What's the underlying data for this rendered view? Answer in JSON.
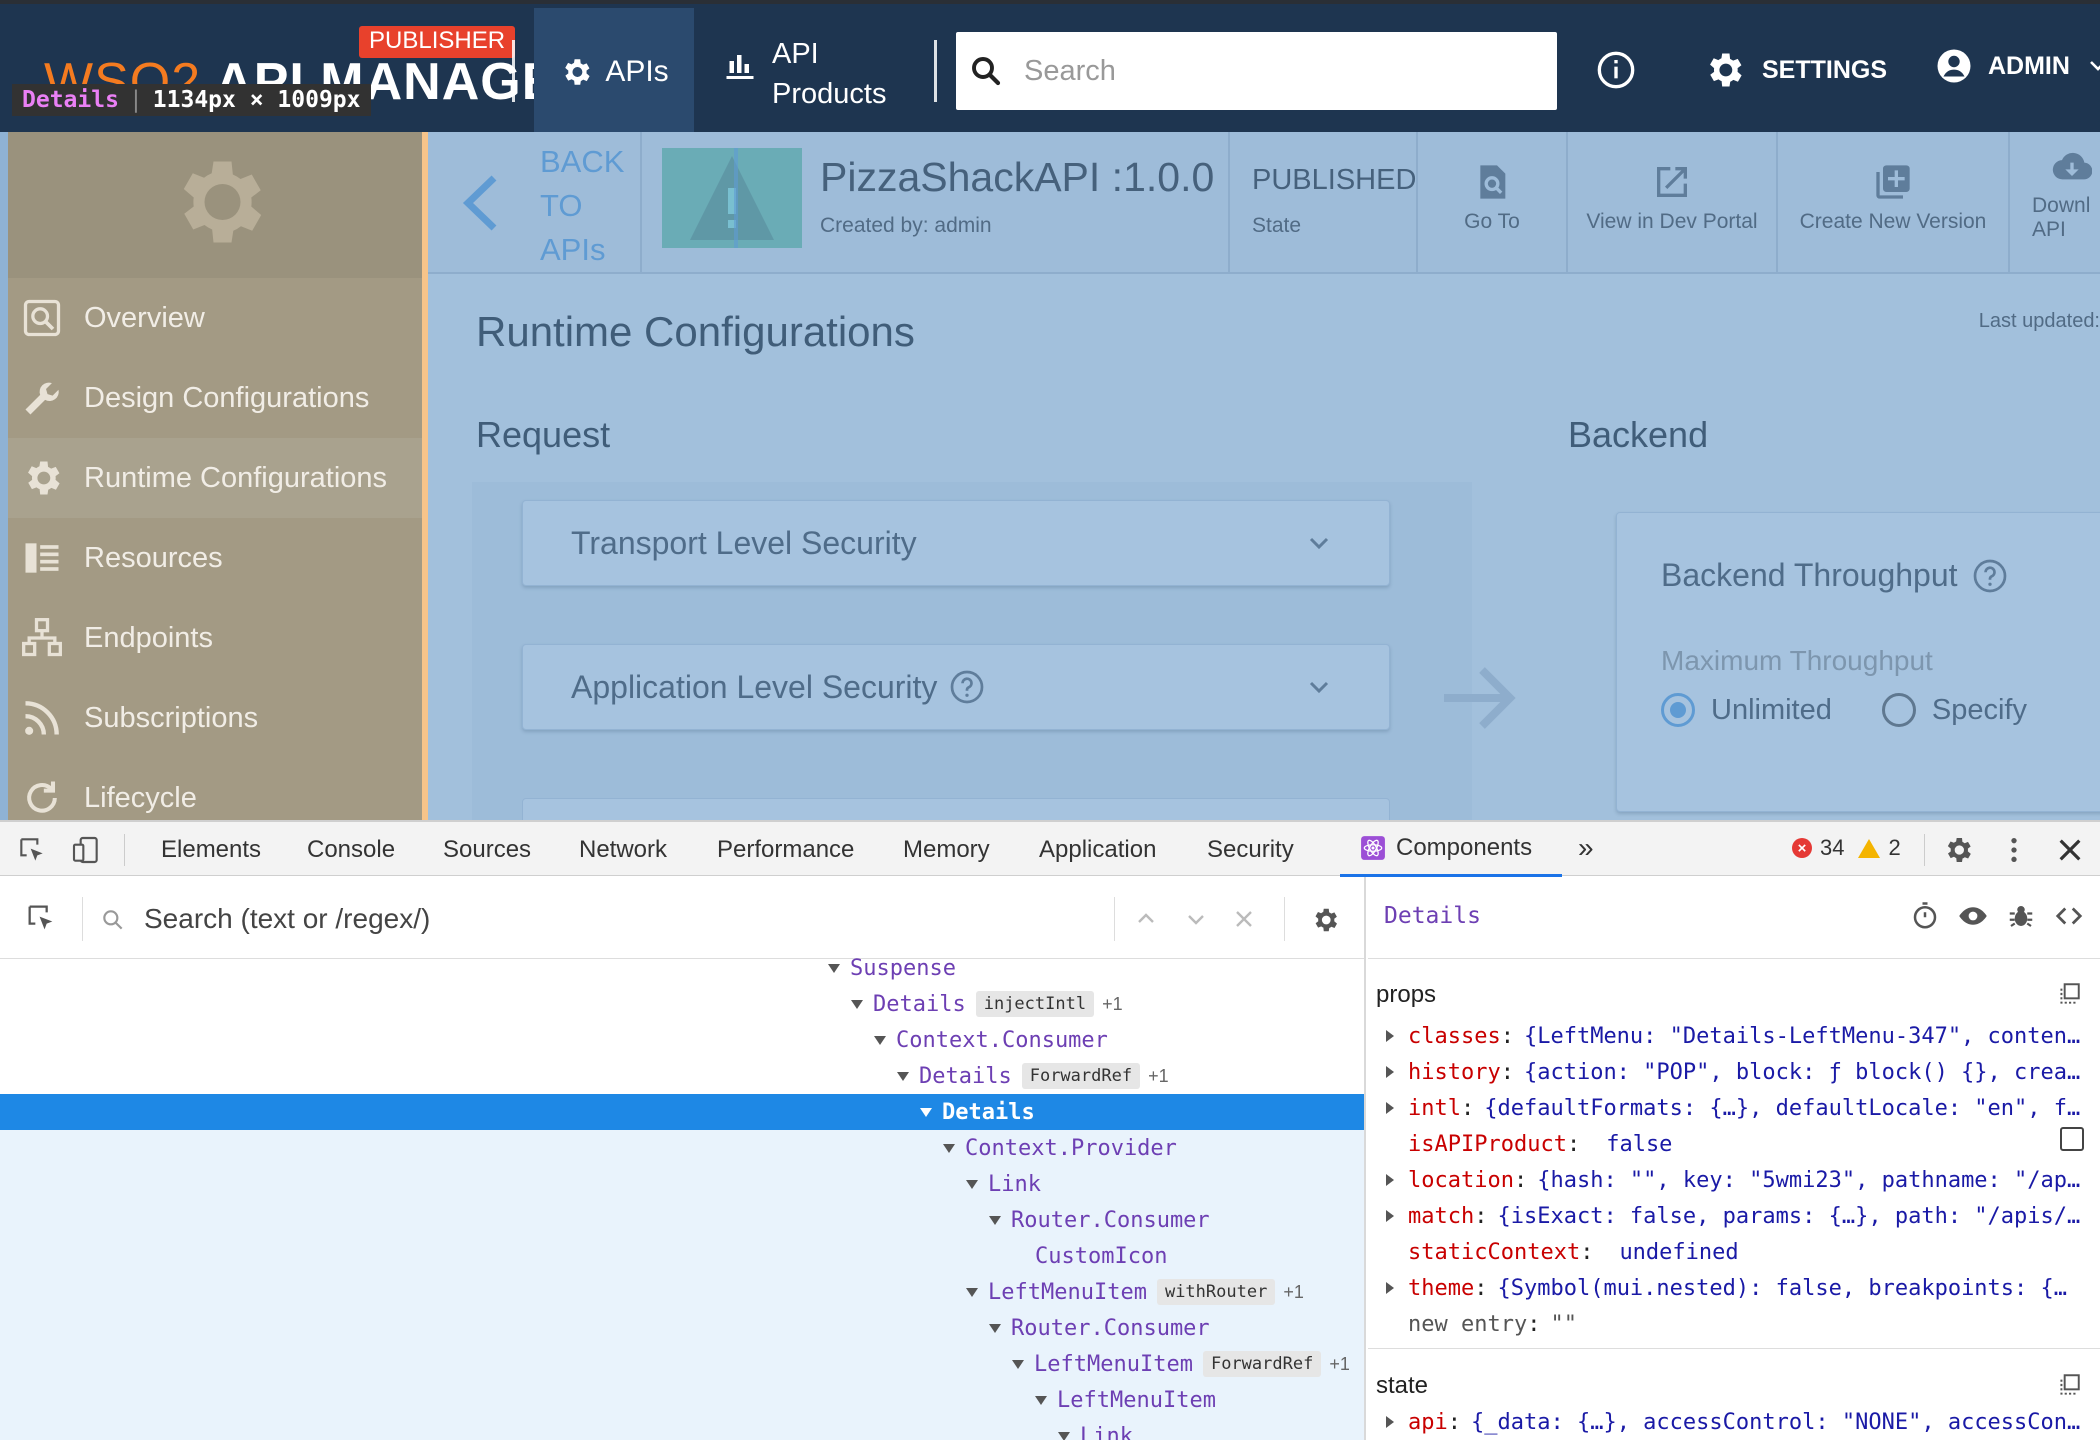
{
  "topbar": {
    "logo_prefix": "WSO2",
    "logo_text": "API MANAGER",
    "publisher_badge": "PUBLISHER",
    "nav_apis": "APIs",
    "nav_api_products_line1": "API",
    "nav_api_products_line2": "Products",
    "search_placeholder": "Search",
    "settings_label": "SETTINGS",
    "admin_label": "ADMIN",
    "dims_tooltip_name": "Details",
    "dims_tooltip_size": "1134px × 1009px"
  },
  "leftmenu": {
    "items": [
      {
        "label": "Overview",
        "icon": "overview-icon"
      },
      {
        "label": "Design Configurations",
        "icon": "wrench-icon"
      },
      {
        "label": "Runtime Configurations",
        "icon": "gear-icon"
      },
      {
        "label": "Resources",
        "icon": "resources-icon"
      },
      {
        "label": "Endpoints",
        "icon": "endpoints-icon"
      },
      {
        "label": "Subscriptions",
        "icon": "rss-icon"
      },
      {
        "label": "Lifecycle",
        "icon": "lifecycle-icon"
      }
    ],
    "active_index": 2
  },
  "subheader": {
    "back_line1": "BACK",
    "back_line2": "TO",
    "back_line3": "APIs",
    "api_name": "PizzaShackAPI :1.0.0",
    "created_by": "Created by: admin",
    "state_value": "PUBLISHED",
    "state_label": "State",
    "go_to": "Go To",
    "view_dev_portal": "View in Dev Portal",
    "create_new_version": "Create New Version",
    "download_line1": "Downl",
    "download_line2": "API"
  },
  "content": {
    "title": "Runtime Configurations",
    "last_updated": "Last updated:",
    "request_heading": "Request",
    "backend_heading": "Backend",
    "transport_security": "Transport Level Security",
    "application_security": "Application Level Security",
    "backend_throughput": "Backend Throughput",
    "max_throughput": "Maximum Throughput",
    "radio_unlimited": "Unlimited",
    "radio_specify": "Specify"
  },
  "devtools": {
    "tabs": [
      "Elements",
      "Console",
      "Sources",
      "Network",
      "Performance",
      "Memory",
      "Application",
      "Security",
      "Components"
    ],
    "active_tab": "Components",
    "error_count": "34",
    "warning_count": "2",
    "tree_search_placeholder": "Search (text or /regex/)",
    "tree": [
      {
        "name": "Suspense",
        "badge": "",
        "plus": ""
      },
      {
        "name": "Details",
        "badge": "injectIntl",
        "plus": "+1"
      },
      {
        "name": "Context.Consumer",
        "badge": "",
        "plus": ""
      },
      {
        "name": "Details",
        "badge": "ForwardRef",
        "plus": "+1"
      },
      {
        "name": "Details",
        "badge": "",
        "plus": ""
      },
      {
        "name": "Context.Provider",
        "badge": "",
        "plus": ""
      },
      {
        "name": "Link",
        "badge": "",
        "plus": ""
      },
      {
        "name": "Router.Consumer",
        "badge": "",
        "plus": ""
      },
      {
        "name": "CustomIcon",
        "badge": "",
        "plus": ""
      },
      {
        "name": "LeftMenuItem",
        "badge": "withRouter",
        "plus": "+1"
      },
      {
        "name": "Router.Consumer",
        "badge": "",
        "plus": ""
      },
      {
        "name": "LeftMenuItem",
        "badge": "ForwardRef",
        "plus": "+1"
      },
      {
        "name": "LeftMenuItem",
        "badge": "",
        "plus": ""
      },
      {
        "name": "Link",
        "badge": "",
        "plus": ""
      }
    ],
    "selected_component": "Details",
    "props_label": "props",
    "state_label": "state",
    "props": [
      {
        "key": "classes",
        "value": "{LeftMenu: \"Details-LeftMenu-347\", conten…",
        "expandable": true
      },
      {
        "key": "history",
        "value": "{action: \"POP\", block: ƒ block() {}, crea…",
        "expandable": true
      },
      {
        "key": "intl",
        "value": "{defaultFormats: {…}, defaultLocale: \"en\", f…",
        "expandable": true
      },
      {
        "key": "isAPIProduct",
        "value": "false",
        "expandable": false
      },
      {
        "key": "location",
        "value": "{hash: \"\", key: \"5wmi23\", pathname: \"/ap…",
        "expandable": true
      },
      {
        "key": "match",
        "value": "{isExact: false, params: {…}, path: \"/apis/…",
        "expandable": true
      },
      {
        "key": "staticContext",
        "value": "undefined",
        "expandable": false
      },
      {
        "key": "theme",
        "value": "{Symbol(mui.nested): false, breakpoints: {…",
        "expandable": true
      }
    ],
    "new_entry_key": "new entry",
    "new_entry_value": "\"\"",
    "state": [
      {
        "key": "api",
        "value": "{_data: {…}, accessControl: \"NONE\", accessCon…",
        "expandable": true
      }
    ]
  }
}
